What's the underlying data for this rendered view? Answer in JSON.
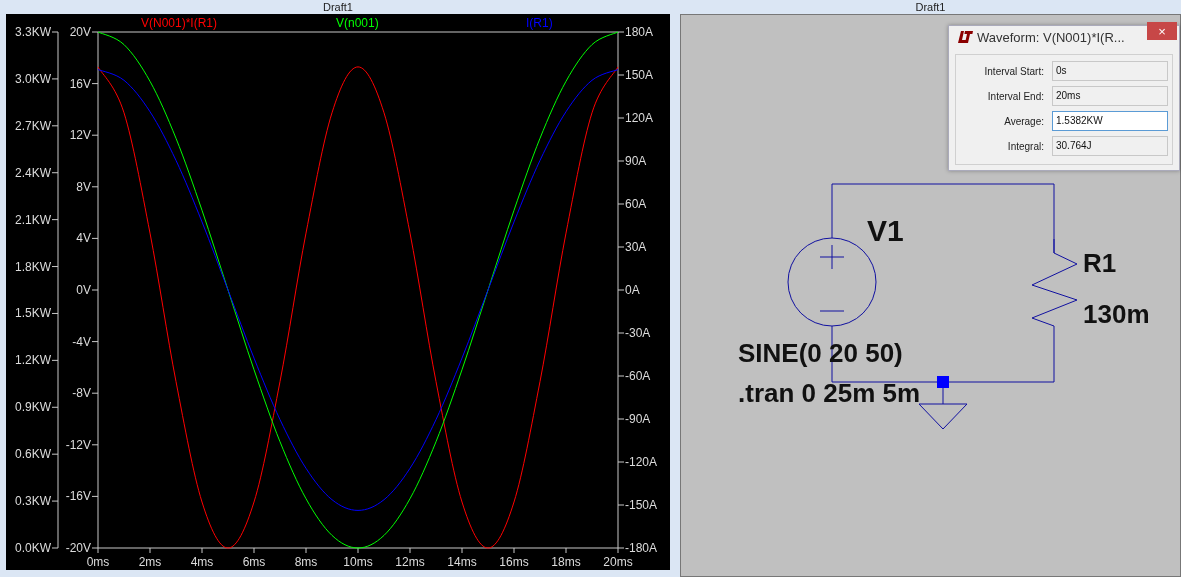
{
  "plot_window": {
    "title": "Draft1",
    "chart_data": {
      "type": "line",
      "x": [
        0,
        1,
        2,
        3,
        4,
        5,
        6,
        7,
        8,
        9,
        10,
        11,
        12,
        13,
        14,
        15,
        16,
        17,
        18,
        19,
        20
      ],
      "xlim": [
        0,
        20
      ],
      "xticks": [
        {
          "value": 0,
          "label": "0ms"
        },
        {
          "value": 2,
          "label": "2ms"
        },
        {
          "value": 4,
          "label": "4ms"
        },
        {
          "value": 6,
          "label": "6ms"
        },
        {
          "value": 8,
          "label": "8ms"
        },
        {
          "value": 10,
          "label": "10ms"
        },
        {
          "value": 12,
          "label": "12ms"
        },
        {
          "value": 14,
          "label": "14ms"
        },
        {
          "value": 16,
          "label": "16ms"
        },
        {
          "value": 18,
          "label": "18ms"
        },
        {
          "value": 20,
          "label": "20ms"
        }
      ],
      "ylim": [
        -20,
        20
      ],
      "yticks": [
        {
          "value": 20,
          "label": "20V"
        },
        {
          "value": 16,
          "label": "16V"
        },
        {
          "value": 12,
          "label": "12V"
        },
        {
          "value": 8,
          "label": "8V"
        },
        {
          "value": 4,
          "label": "4V"
        },
        {
          "value": 0,
          "label": "0V"
        },
        {
          "value": -4,
          "label": "-4V"
        },
        {
          "value": -8,
          "label": "-8V"
        },
        {
          "value": -12,
          "label": "-12V"
        },
        {
          "value": -16,
          "label": "-16V"
        },
        {
          "value": -20,
          "label": "-20V"
        }
      ],
      "y2lim": [
        -180,
        180
      ],
      "y2ticks": [
        {
          "value": 180,
          "label": "180A"
        },
        {
          "value": 150,
          "label": "150A"
        },
        {
          "value": 120,
          "label": "120A"
        },
        {
          "value": 90,
          "label": "90A"
        },
        {
          "value": 60,
          "label": "60A"
        },
        {
          "value": 30,
          "label": "30A"
        },
        {
          "value": 0,
          "label": "0A"
        },
        {
          "value": -30,
          "label": "-30A"
        },
        {
          "value": -60,
          "label": "-60A"
        },
        {
          "value": -90,
          "label": "-90A"
        },
        {
          "value": -120,
          "label": "-120A"
        },
        {
          "value": -150,
          "label": "-150A"
        },
        {
          "value": -180,
          "label": "-180A"
        }
      ],
      "y3lim": [
        0,
        3.3
      ],
      "y3ticks": [
        {
          "value": 3.3,
          "label": "3.3KW"
        },
        {
          "value": 3.0,
          "label": "3.0KW"
        },
        {
          "value": 2.7,
          "label": "2.7KW"
        },
        {
          "value": 2.4,
          "label": "2.4KW"
        },
        {
          "value": 2.1,
          "label": "2.1KW"
        },
        {
          "value": 1.8,
          "label": "1.8KW"
        },
        {
          "value": 1.5,
          "label": "1.5KW"
        },
        {
          "value": 1.2,
          "label": "1.2KW"
        },
        {
          "value": 0.9,
          "label": "0.9KW"
        },
        {
          "value": 0.6,
          "label": "0.6KW"
        },
        {
          "value": 0.3,
          "label": "0.3KW"
        },
        {
          "value": 0.0,
          "label": "0.0KW"
        }
      ],
      "series": [
        {
          "name": "V(N001)*I(R1)",
          "color": "#ff0000",
          "axis": "y3",
          "values": [
            3.077,
            2.783,
            2.014,
            1.064,
            0.294,
            0,
            0.294,
            1.064,
            2.014,
            2.783,
            3.077,
            2.783,
            2.014,
            1.064,
            0.294,
            0,
            0.294,
            1.064,
            2.014,
            2.783,
            3.077
          ]
        },
        {
          "name": "V(n001)",
          "color": "#00ff00",
          "axis": "y",
          "values": [
            20,
            19.02,
            16.18,
            11.76,
            6.18,
            0,
            -6.18,
            -11.76,
            -16.18,
            -19.02,
            -20,
            -19.02,
            -16.18,
            -11.76,
            -6.18,
            0,
            6.18,
            11.76,
            16.18,
            19.02,
            20
          ]
        },
        {
          "name": "I(R1)",
          "color": "#0000ff",
          "axis": "y2",
          "values": [
            153.8,
            146.3,
            124.4,
            90.4,
            47.5,
            0,
            -47.5,
            -90.4,
            -124.4,
            -146.3,
            -153.8,
            -146.3,
            -124.4,
            -90.4,
            -47.5,
            0,
            47.5,
            90.4,
            124.4,
            146.3,
            153.8
          ]
        }
      ]
    }
  },
  "schematic_window": {
    "title": "Draft1",
    "components": [
      {
        "kind": "voltage_source",
        "name": "V1",
        "value": "SINE(0 20 50)"
      },
      {
        "kind": "resistor",
        "name": "R1",
        "value": "130m"
      }
    ],
    "directive": ".tran 0 25m 5m"
  },
  "waveform_dialog": {
    "title": "Waveform: V(N001)*I(R...",
    "close": "×",
    "fields": [
      {
        "label": "Interval Start:",
        "value": "0s",
        "focused": false
      },
      {
        "label": "Interval End:",
        "value": "20ms",
        "focused": false
      },
      {
        "label": "Average:",
        "value": "1.5382KW",
        "focused": true
      },
      {
        "label": "Integral:",
        "value": "30.764J",
        "focused": false
      }
    ]
  }
}
